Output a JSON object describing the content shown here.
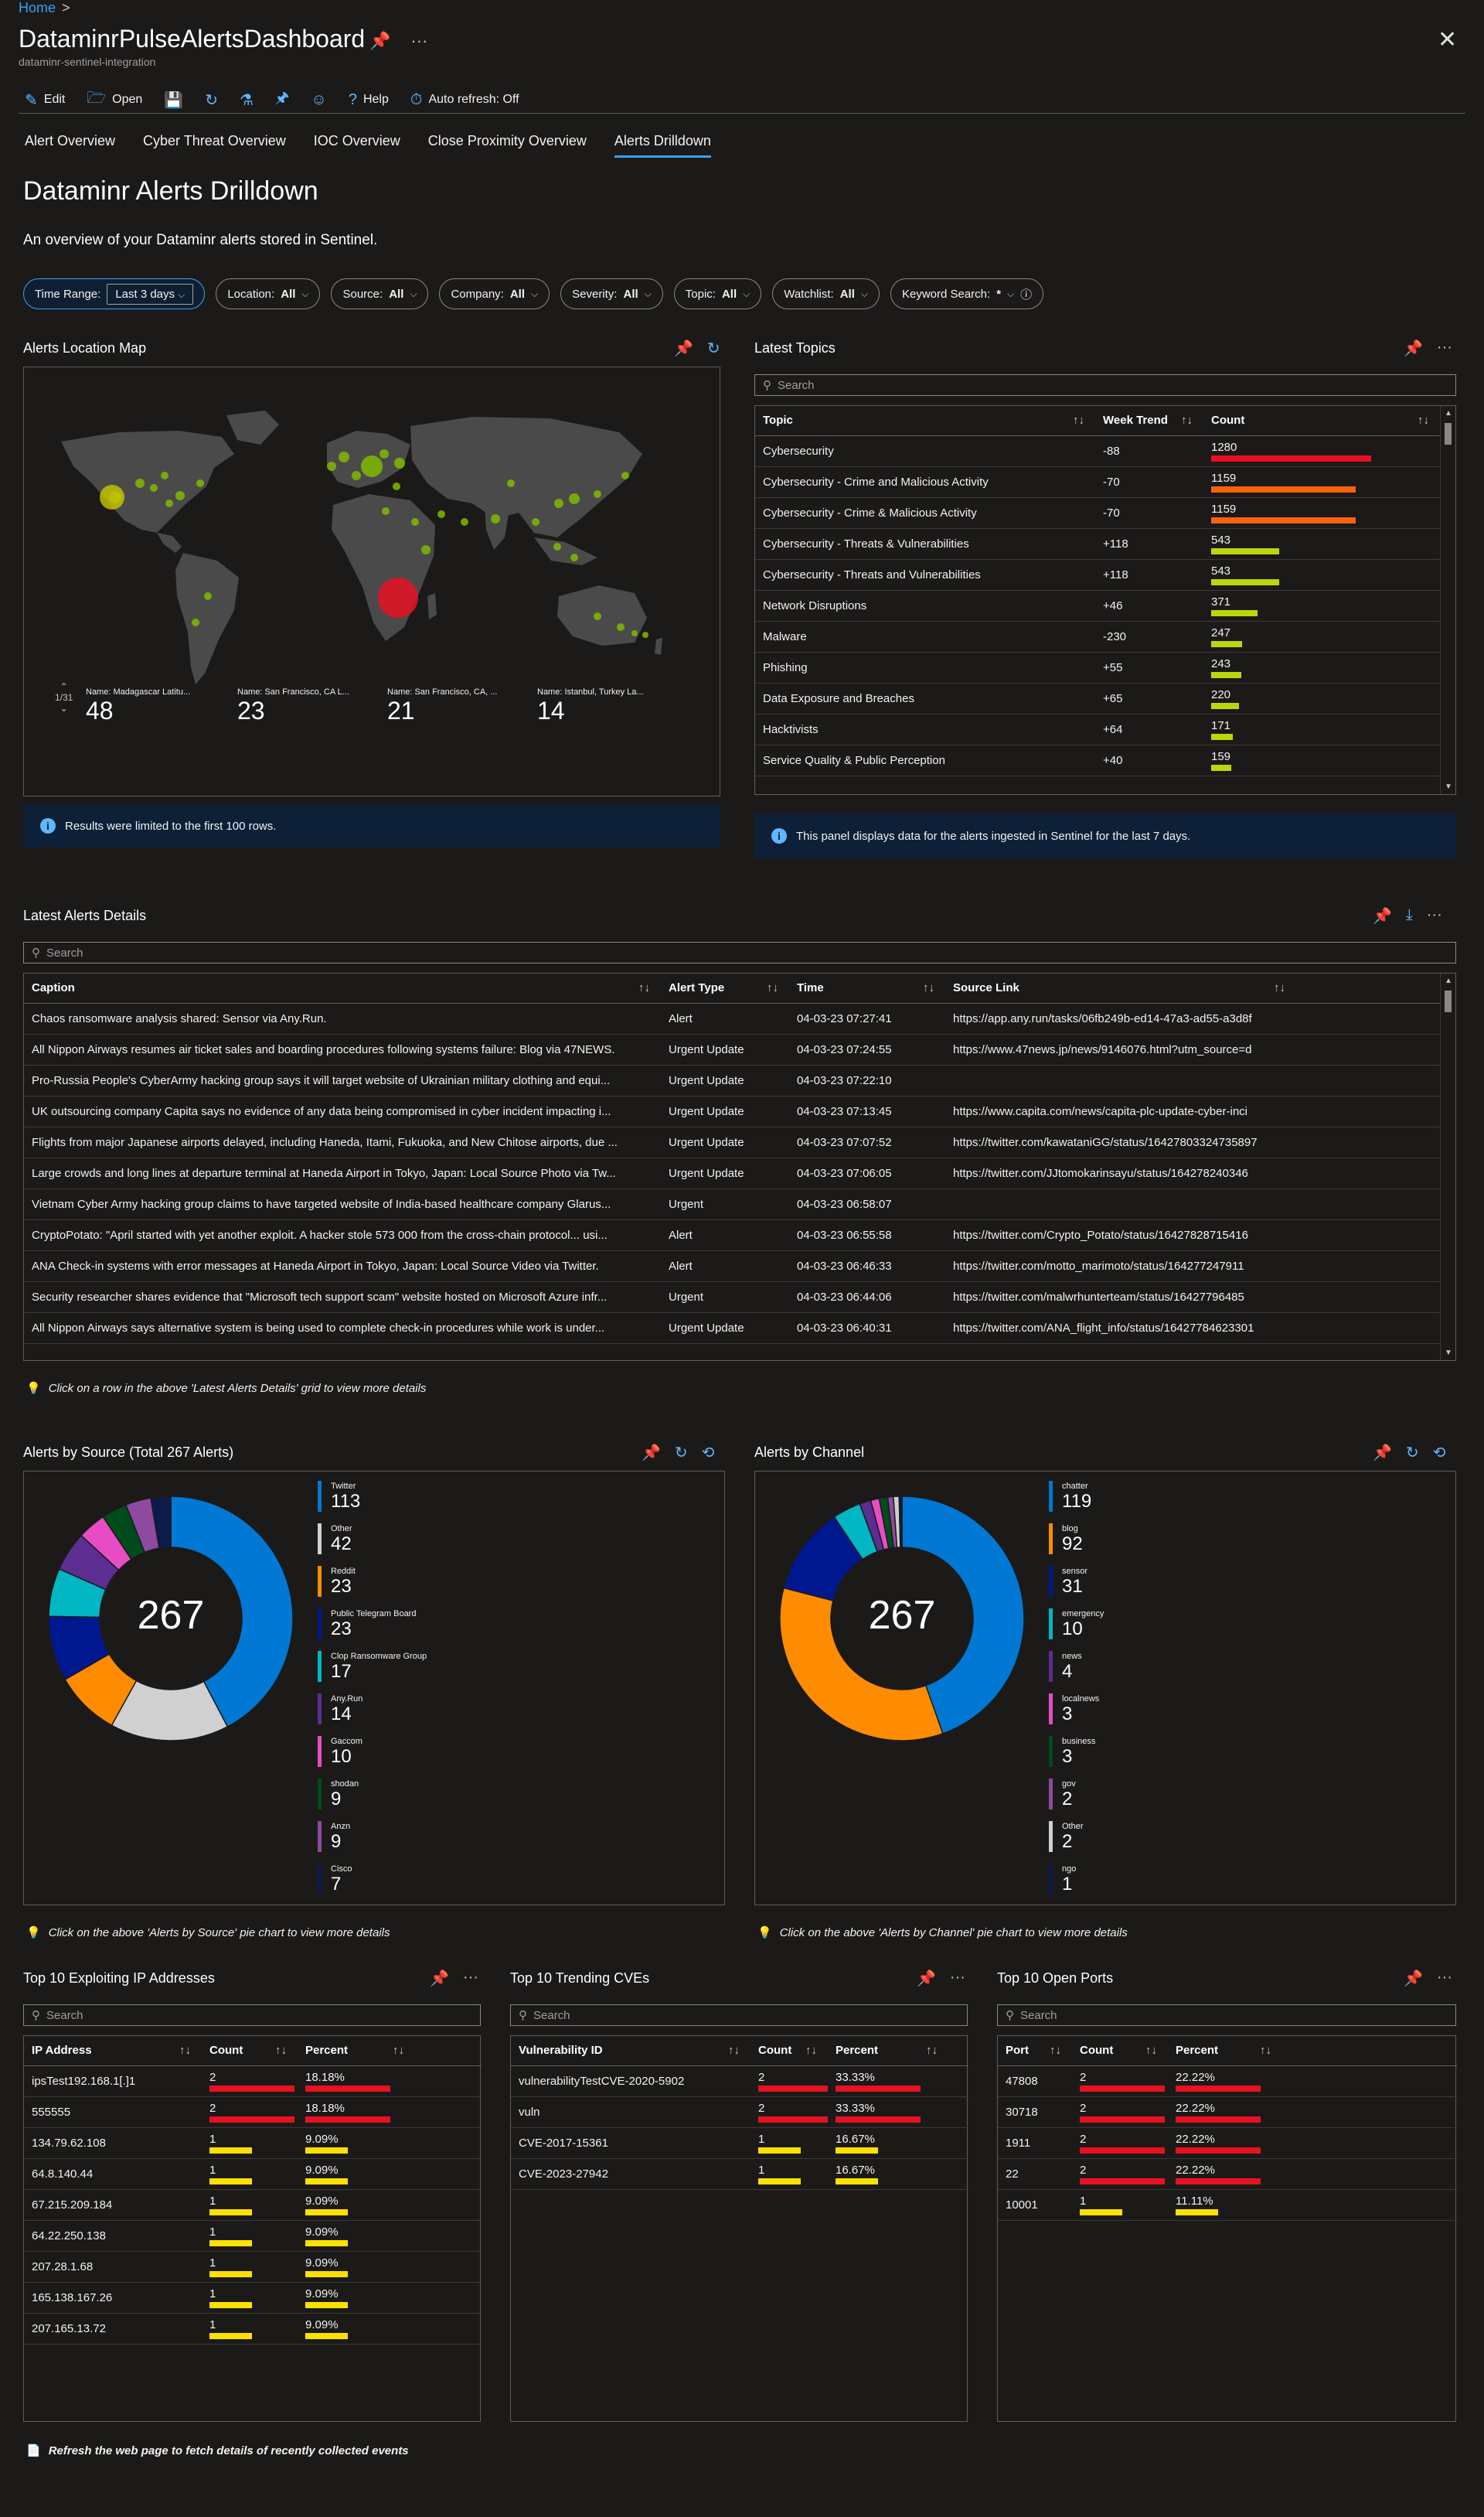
{
  "breadcrumb": {
    "home": "Home",
    "sep": ">"
  },
  "header": {
    "title": "DataminrPulseAlertsDashboard",
    "subtitle": "dataminr-sentinel-integration",
    "pin_icon": "pin-icon",
    "more_icon": "more-icon",
    "close_icon": "close-icon"
  },
  "commandbar": {
    "edit": "Edit",
    "open": "Open",
    "help": "Help",
    "auto_refresh": "Auto refresh: Off"
  },
  "tabs": [
    {
      "label": "Alert Overview"
    },
    {
      "label": "Cyber Threat Overview"
    },
    {
      "label": "IOC Overview"
    },
    {
      "label": "Close Proximity Overview"
    },
    {
      "label": "Alerts Drilldown",
      "active": true
    }
  ],
  "page": {
    "heading": "Dataminr Alerts Drilldown",
    "description": "An overview of your Dataminr alerts stored in Sentinel."
  },
  "filters": {
    "time_range_label": "Time Range:",
    "time_range_value": "Last 3 days",
    "location_label": "Location:",
    "location_value": "All",
    "source_label": "Source:",
    "source_value": "All",
    "company_label": "Company:",
    "company_value": "All",
    "severity_label": "Severity:",
    "severity_value": "All",
    "topic_label": "Topic:",
    "topic_value": "All",
    "watchlist_label": "Watchlist:",
    "watchlist_value": "All",
    "keyword_label": "Keyword Search:",
    "keyword_value": "*"
  },
  "map_panel": {
    "title": "Alerts Location Map",
    "pager": "1/31",
    "stats": [
      {
        "name": "Name: Madagascar Latitu...",
        "value": "48"
      },
      {
        "name": "Name: San Francisco, CA L...",
        "value": "23"
      },
      {
        "name": "Name: San Francisco, CA, ...",
        "value": "21"
      },
      {
        "name": "Name: Istanbul, Turkey La...",
        "value": "14"
      }
    ],
    "info": "Results were limited to the first 100 rows."
  },
  "topics_panel": {
    "title": "Latest Topics",
    "search_placeholder": "Search",
    "columns": {
      "topic": "Topic",
      "trend": "Week Trend",
      "count": "Count"
    },
    "max_count": 1300,
    "rows": [
      {
        "topic": "Cybersecurity",
        "trend": "-88",
        "count": 1280,
        "color": "#e81123"
      },
      {
        "topic": "Cybersecurity - Crime and Malicious Activity",
        "trend": "-70",
        "count": 1159,
        "color": "#f7630c"
      },
      {
        "topic": "Cybersecurity - Crime & Malicious Activity",
        "trend": "-70",
        "count": 1159,
        "color": "#f7630c"
      },
      {
        "topic": "Cybersecurity - Threats & Vulnerabilities",
        "trend": "+118",
        "count": 543,
        "color": "#bad80a"
      },
      {
        "topic": "Cybersecurity - Threats and Vulnerabilities",
        "trend": "+118",
        "count": 543,
        "color": "#bad80a"
      },
      {
        "topic": "Network Disruptions",
        "trend": "+46",
        "count": 371,
        "color": "#bad80a"
      },
      {
        "topic": "Malware",
        "trend": "-230",
        "count": 247,
        "color": "#bad80a"
      },
      {
        "topic": "Phishing",
        "trend": "+55",
        "count": 243,
        "color": "#bad80a"
      },
      {
        "topic": "Data Exposure and Breaches",
        "trend": "+65",
        "count": 220,
        "color": "#bad80a"
      },
      {
        "topic": "Hacktivists",
        "trend": "+64",
        "count": 171,
        "color": "#bad80a"
      },
      {
        "topic": "Service Quality & Public Perception",
        "trend": "+40",
        "count": 159,
        "color": "#bad80a"
      }
    ],
    "info": "This panel displays data for the alerts ingested in Sentinel for the last 7 days."
  },
  "alerts_panel": {
    "title": "Latest Alerts Details",
    "search_placeholder": "Search",
    "columns": {
      "caption": "Caption",
      "type": "Alert Type",
      "time": "Time",
      "link": "Source Link"
    },
    "rows": [
      {
        "caption": "Chaos ransomware analysis shared: Sensor via Any.Run.",
        "type": "Alert",
        "time": "04-03-23 07:27:41",
        "link": "https://app.any.run/tasks/06fb249b-ed14-47a3-ad55-a3d8f"
      },
      {
        "caption": "All Nippon Airways resumes air ticket sales and boarding procedures following systems failure: Blog via 47NEWS.",
        "type": "Urgent Update",
        "time": "04-03-23 07:24:55",
        "link": "https://www.47news.jp/news/9146076.html?utm_source=d"
      },
      {
        "caption": "Pro-Russia People's CyberArmy hacking group says it will target website of Ukrainian military clothing and equi...",
        "type": "Urgent Update",
        "time": "04-03-23 07:22:10",
        "link": ""
      },
      {
        "caption": "UK outsourcing company Capita says no evidence of any data being compromised in cyber incident impacting i...",
        "type": "Urgent Update",
        "time": "04-03-23 07:13:45",
        "link": "https://www.capita.com/news/capita-plc-update-cyber-inci"
      },
      {
        "caption": "Flights from major Japanese airports delayed, including Haneda, Itami, Fukuoka, and New Chitose airports, due ...",
        "type": "Urgent Update",
        "time": "04-03-23 07:07:52",
        "link": "https://twitter.com/kawataniGG/status/16427803324735897"
      },
      {
        "caption": "Large crowds and long lines at departure terminal at Haneda Airport in Tokyo, Japan: Local Source Photo via Tw...",
        "type": "Urgent Update",
        "time": "04-03-23 07:06:05",
        "link": "https://twitter.com/JJtomokarinsayu/status/164278240346"
      },
      {
        "caption": "Vietnam Cyber Army hacking group claims to have targeted website of India-based healthcare company Glarus...",
        "type": "Urgent",
        "time": "04-03-23 06:58:07",
        "link": ""
      },
      {
        "caption": "CryptoPotato: \"April started with yet another exploit. A hacker stole 573 000 from the cross-chain protocol... usi...",
        "type": "Alert",
        "time": "04-03-23 06:55:58",
        "link": "https://twitter.com/Crypto_Potato/status/16427828715416"
      },
      {
        "caption": "ANA Check-in systems with error messages at Haneda Airport in Tokyo, Japan: Local Source Video via Twitter.",
        "type": "Alert",
        "time": "04-03-23 06:46:33",
        "link": "https://twitter.com/motto_marimoto/status/164277247911"
      },
      {
        "caption": "Security researcher shares evidence that \"Microsoft tech support scam\" website hosted on Microsoft Azure infr...",
        "type": "Urgent",
        "time": "04-03-23 06:44:06",
        "link": "https://twitter.com/malwrhunterteam/status/16427796485"
      },
      {
        "caption": "All Nippon Airways says alternative system is being used to complete check-in procedures while work is under...",
        "type": "Urgent Update",
        "time": "04-03-23 06:40:31",
        "link": "https://twitter.com/ANA_flight_info/status/16427784623301"
      }
    ],
    "hint": "Click on a row in the above 'Latest Alerts Details' grid to view more details"
  },
  "source_panel": {
    "title": "Alerts by Source (Total 267 Alerts)",
    "total": "267",
    "hint": "Click on the above 'Alerts by Source' pie chart to view more details"
  },
  "channel_panel": {
    "title": "Alerts by Channel",
    "total": "267",
    "hint": "Click on the above 'Alerts by Channel' pie chart to view more details"
  },
  "chart_data": [
    {
      "type": "pie",
      "title": "Alerts by Source (Total 267 Alerts)",
      "categories": [
        "Twitter",
        "Other",
        "Reddit",
        "Public Telegram Board",
        "Clop Ransomware Group",
        "Any.Run",
        "Gaccom",
        "shodan",
        "Anzn",
        "Cisco"
      ],
      "values": [
        113,
        42,
        23,
        23,
        17,
        14,
        10,
        9,
        9,
        7
      ],
      "colors": [
        "#0078d4",
        "#d0d0d0",
        "#ff8c00",
        "#00188f",
        "#00b7c3",
        "#5c2e91",
        "#e74cc4",
        "#004b1c",
        "#8e4a9e",
        "#0d1a4a"
      ],
      "legend": "right"
    },
    {
      "type": "pie",
      "title": "Alerts by Channel",
      "categories": [
        "chatter",
        "blog",
        "sensor",
        "emergency",
        "news",
        "localnews",
        "business",
        "gov",
        "Other",
        "ngo"
      ],
      "values": [
        119,
        92,
        31,
        10,
        4,
        3,
        3,
        2,
        2,
        1
      ],
      "colors": [
        "#0078d4",
        "#ff8c00",
        "#00188f",
        "#00b7c3",
        "#5c2e91",
        "#e74cc4",
        "#004b1c",
        "#8e4a9e",
        "#d0d0d0",
        "#0d1a4a"
      ],
      "legend": "right"
    }
  ],
  "ip_panel": {
    "title": "Top 10 Exploiting IP Addresses",
    "search_placeholder": "Search",
    "columns": {
      "a": "IP Address",
      "b": "Count",
      "c": "Percent"
    },
    "rows": [
      {
        "a": "ipsTest192.168.1[.]1",
        "b": "2",
        "c": "18.18%",
        "frac": 0.1818,
        "color": "#e81123"
      },
      {
        "a": "555555",
        "b": "2",
        "c": "18.18%",
        "frac": 0.1818,
        "color": "#e81123"
      },
      {
        "a": "134.79.62.108",
        "b": "1",
        "c": "9.09%",
        "frac": 0.0909,
        "color": "#fce100"
      },
      {
        "a": "64.8.140.44",
        "b": "1",
        "c": "9.09%",
        "frac": 0.0909,
        "color": "#fce100"
      },
      {
        "a": "67.215.209.184",
        "b": "1",
        "c": "9.09%",
        "frac": 0.0909,
        "color": "#fce100"
      },
      {
        "a": "64.22.250.138",
        "b": "1",
        "c": "9.09%",
        "frac": 0.0909,
        "color": "#fce100"
      },
      {
        "a": "207.28.1.68",
        "b": "1",
        "c": "9.09%",
        "frac": 0.0909,
        "color": "#fce100"
      },
      {
        "a": "165.138.167.26",
        "b": "1",
        "c": "9.09%",
        "frac": 0.0909,
        "color": "#fce100"
      },
      {
        "a": "207.165.13.72",
        "b": "1",
        "c": "9.09%",
        "frac": 0.0909,
        "color": "#fce100"
      }
    ]
  },
  "cve_panel": {
    "title": "Top 10 Trending CVEs",
    "search_placeholder": "Search",
    "columns": {
      "a": "Vulnerability ID",
      "b": "Count",
      "c": "Percent"
    },
    "rows": [
      {
        "a": "vulnerabilityTestCVE-2020-5902",
        "b": "2",
        "c": "33.33%",
        "frac": 0.3333,
        "color": "#e81123"
      },
      {
        "a": "vuln",
        "b": "2",
        "c": "33.33%",
        "frac": 0.3333,
        "color": "#e81123"
      },
      {
        "a": "CVE-2017-15361",
        "b": "1",
        "c": "16.67%",
        "frac": 0.1667,
        "color": "#fce100"
      },
      {
        "a": "CVE-2023-27942",
        "b": "1",
        "c": "16.67%",
        "frac": 0.1667,
        "color": "#fce100"
      }
    ]
  },
  "ports_panel": {
    "title": "Top 10 Open Ports",
    "search_placeholder": "Search",
    "columns": {
      "a": "Port",
      "b": "Count",
      "c": "Percent"
    },
    "rows": [
      {
        "a": "47808",
        "b": "2",
        "c": "22.22%",
        "frac": 0.2222,
        "color": "#e81123"
      },
      {
        "a": "30718",
        "b": "2",
        "c": "22.22%",
        "frac": 0.2222,
        "color": "#e81123"
      },
      {
        "a": "1911",
        "b": "2",
        "c": "22.22%",
        "frac": 0.2222,
        "color": "#e81123"
      },
      {
        "a": "22",
        "b": "2",
        "c": "22.22%",
        "frac": 0.2222,
        "color": "#e81123"
      },
      {
        "a": "10001",
        "b": "1",
        "c": "11.11%",
        "frac": 0.1111,
        "color": "#fce100"
      }
    ]
  },
  "footer": {
    "note": "Refresh the web page to fetch details of recently collected events"
  }
}
